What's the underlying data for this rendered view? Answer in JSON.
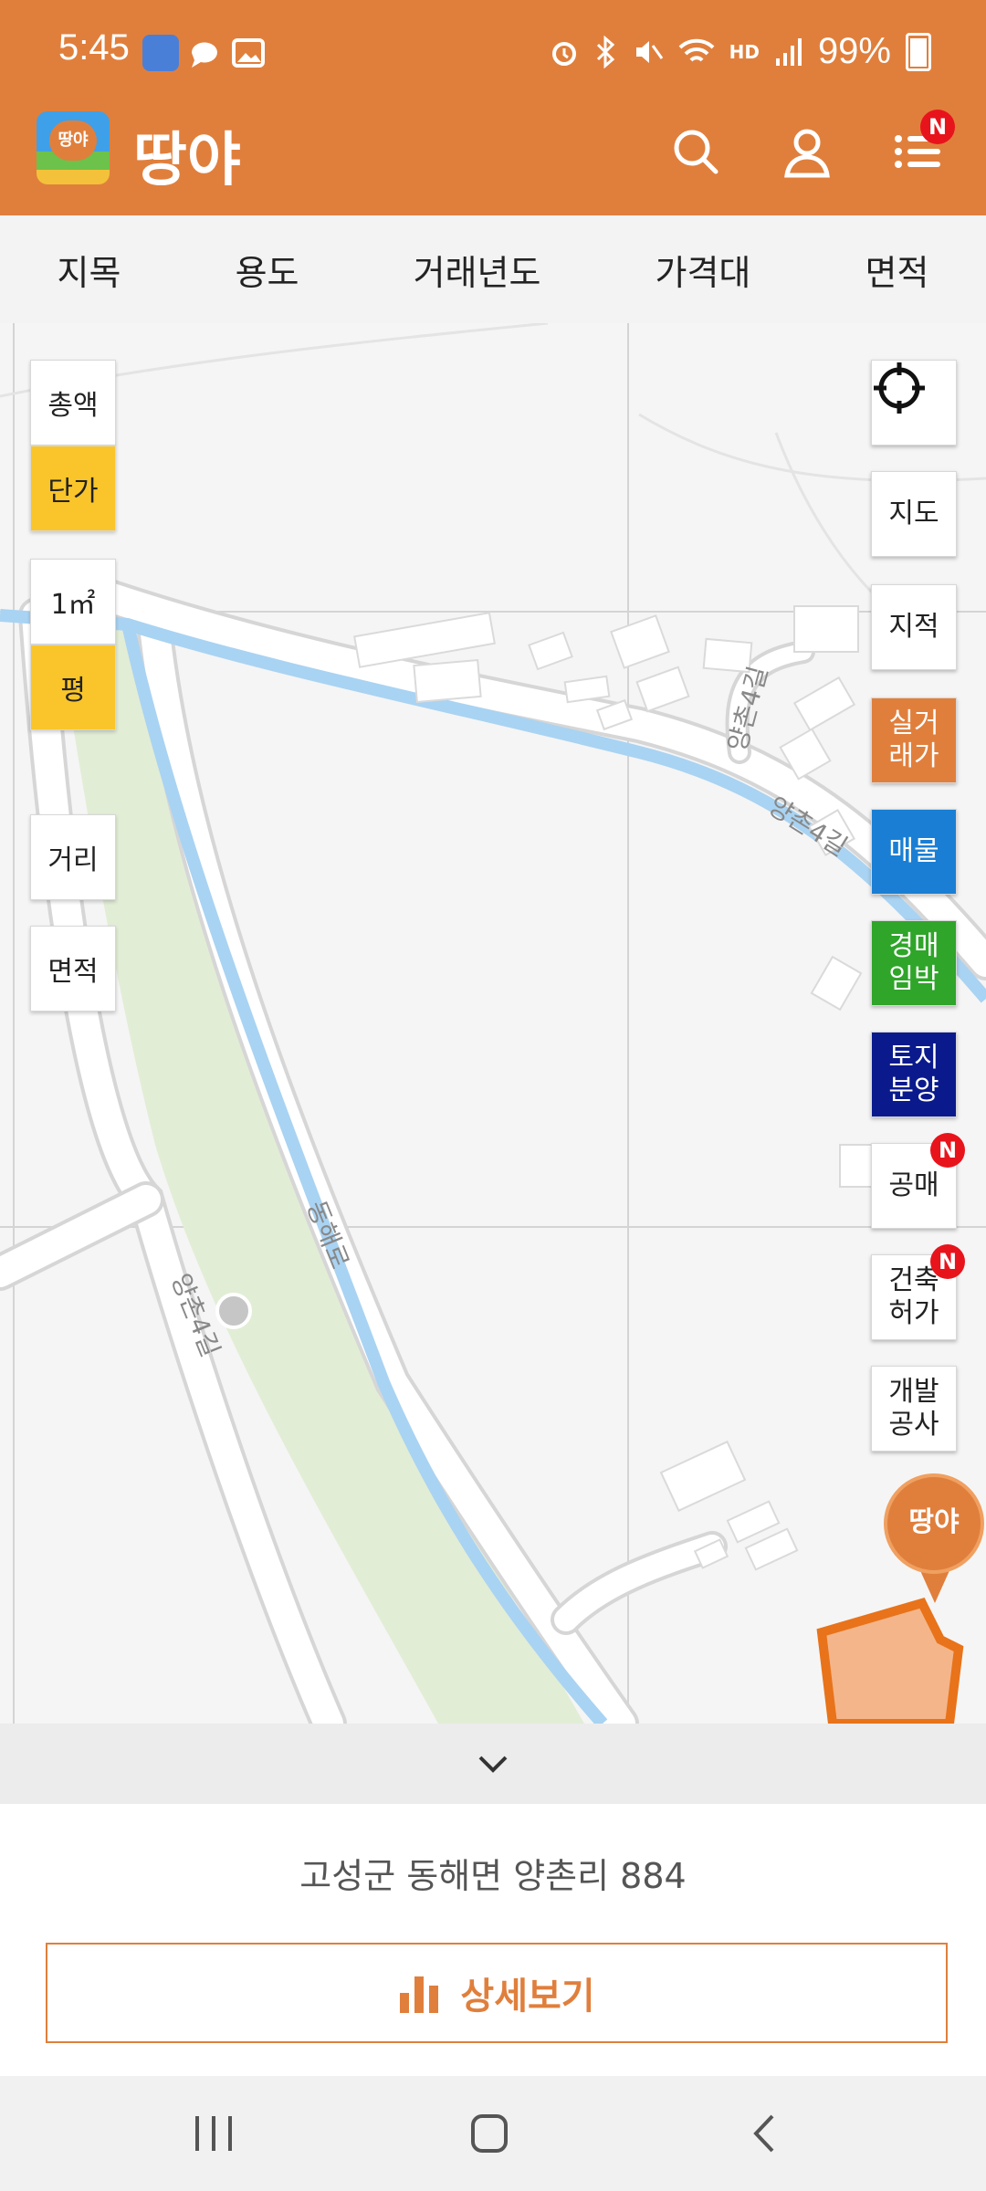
{
  "status": {
    "time": "5:45",
    "battery": "99%",
    "network": "HD"
  },
  "app": {
    "name": "땅야",
    "logo_text": "땅야"
  },
  "header": {
    "menu_badge": "N"
  },
  "filters": [
    "지목",
    "용도",
    "거래년도",
    "가격대",
    "면적"
  ],
  "left_controls": {
    "total": "총액",
    "unit_price": "단가",
    "sqm": "1㎡",
    "pyeong": "평",
    "distance": "거리",
    "area": "면적"
  },
  "right_controls": {
    "map": "지도",
    "cadastral": "지적",
    "real_trade": "실거\n래가",
    "listing": "매물",
    "auction": "경매\n임박",
    "land_sale": "토지\n분양",
    "public_sale": "공매",
    "building_permit": "건축\n허가",
    "development": "개발\n공사",
    "new_badge": "N"
  },
  "map": {
    "roads": [
      "양촌4길",
      "양촌4길",
      "동해로"
    ],
    "marker": "땅야"
  },
  "sheet": {
    "address": "고성군 동해면 양촌리 884",
    "detail_button": "상세보기"
  },
  "colors": {
    "brand": "#E07F3C",
    "toggle_on": "#F9C52A",
    "real_trade": "#E07F3C",
    "listing": "#1A7FD4",
    "auction": "#2FA52A",
    "land_sale": "#0A1A8C",
    "badge": "#E8141C"
  }
}
